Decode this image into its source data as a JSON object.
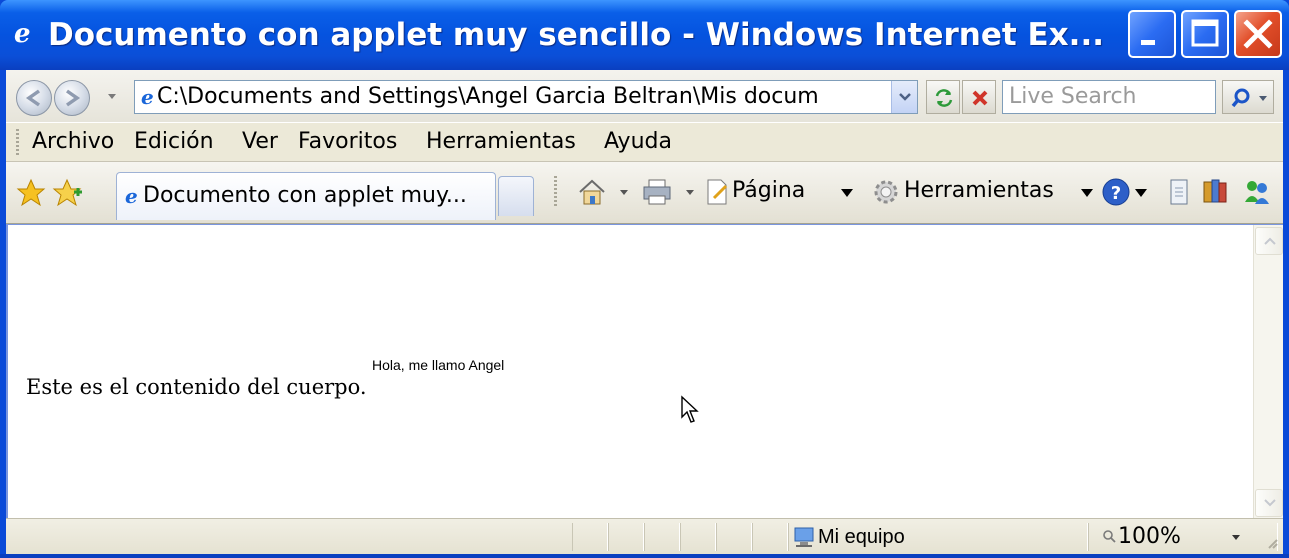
{
  "window": {
    "title": "Documento con applet muy sencillo - Windows Internet Ex...",
    "controls": {
      "minimize": "minimize",
      "maximize": "maximize",
      "close": "close"
    }
  },
  "address_bar": {
    "url": "C:\\Documents and Settings\\Angel Garcia Beltran\\Mis docum",
    "search_placeholder": "Live Search"
  },
  "menu": {
    "items": [
      "Archivo",
      "Edición",
      "Ver",
      "Favoritos",
      "Herramientas",
      "Ayuda"
    ]
  },
  "tabs": {
    "active_label": "Documento con applet muy..."
  },
  "command_bar": {
    "page_label": "Página",
    "tools_label": "Herramientas"
  },
  "page": {
    "body_text": "Este es el contenido del cuerpo.",
    "applet_text": "Hola, me llamo Angel"
  },
  "status_bar": {
    "zone": "Mi equipo",
    "zoom": "100%"
  },
  "colors": {
    "titlebar": "#0553df",
    "close_button": "#e24f2a",
    "chrome": "#ece9d8"
  },
  "icons": {
    "title": "ie-logo-icon",
    "back": "back-arrow-icon",
    "forward": "forward-arrow-icon",
    "refresh": "refresh-icon",
    "stop": "stop-icon",
    "search": "magnifier-icon",
    "favorites": "star-icon",
    "add_favorite": "add-favorite-icon",
    "home": "home-icon",
    "print": "printer-icon",
    "page": "page-icon",
    "tools": "gear-icon",
    "help": "help-icon",
    "research": "research-icon",
    "messenger": "messenger-icon",
    "zone": "computer-icon",
    "zoom": "zoom-icon"
  }
}
